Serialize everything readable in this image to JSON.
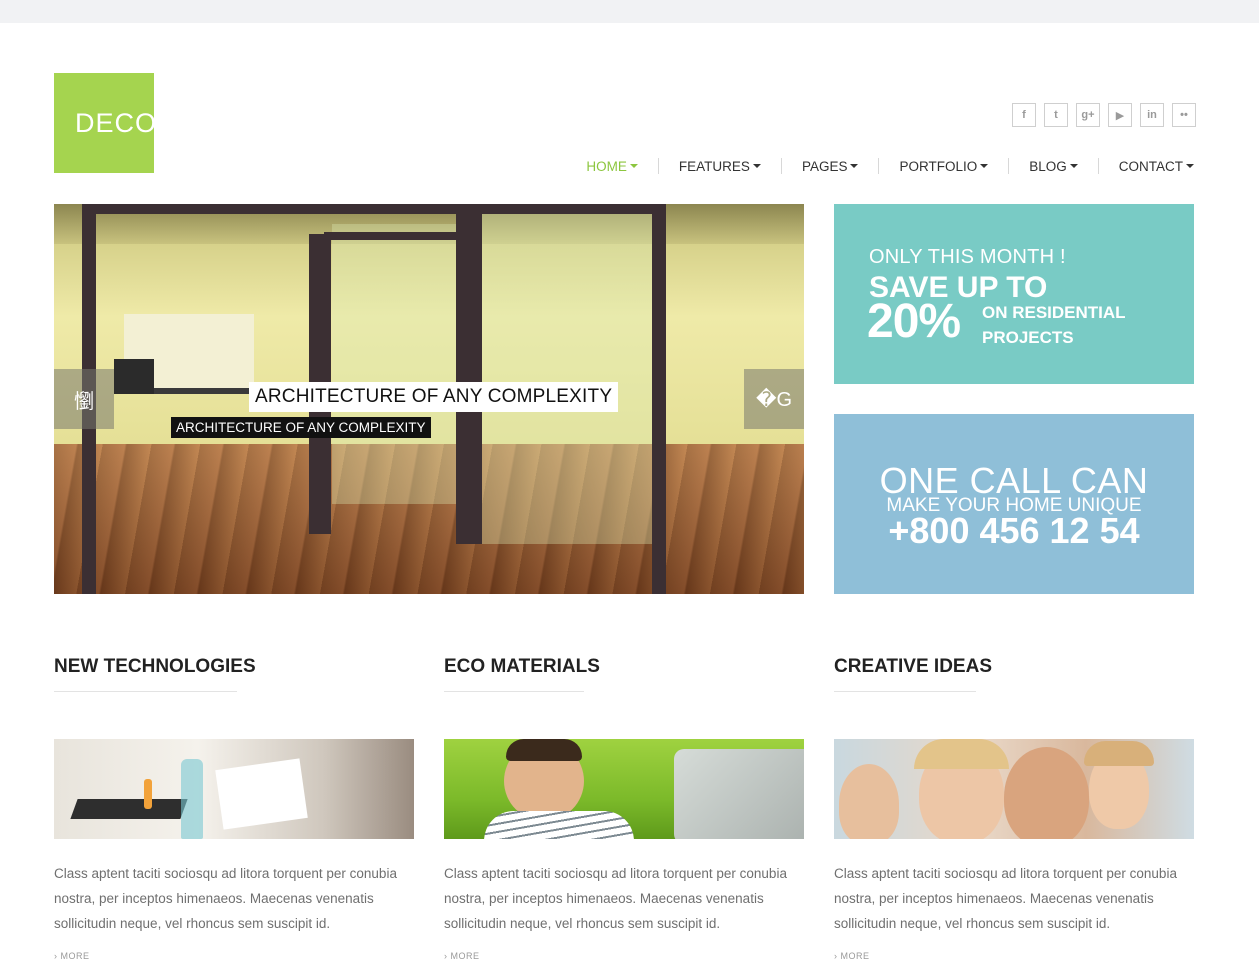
{
  "logo": {
    "text": "DECOR"
  },
  "social": {
    "items": [
      {
        "icon": "facebook-icon",
        "glyph": "f"
      },
      {
        "icon": "twitter-icon",
        "glyph": "t"
      },
      {
        "icon": "google-plus-icon",
        "glyph": "g+"
      },
      {
        "icon": "youtube-icon",
        "glyph": "▶"
      },
      {
        "icon": "linkedin-icon",
        "glyph": "in"
      },
      {
        "icon": "flickr-icon",
        "glyph": "••"
      }
    ]
  },
  "nav": {
    "items": [
      {
        "label": "HOME",
        "active": true
      },
      {
        "label": "FEATURES",
        "active": false
      },
      {
        "label": "PAGES",
        "active": false
      },
      {
        "label": "PORTFOLIO",
        "active": false
      },
      {
        "label": "BLOG",
        "active": false
      },
      {
        "label": "CONTACT",
        "active": false
      }
    ],
    "active_color": "#8cc63f"
  },
  "hero": {
    "caption_title": "ARCHITECTURE OF ANY COMPLEXITY",
    "caption_subtitle": "ARCHITECTURE OF ANY COMPLEXITY",
    "prev_icon": "懰",
    "next_icon": "�G"
  },
  "promo_sale": {
    "line1": "ONLY THIS MONTH !",
    "line2": "SAVE UP TO",
    "line3": "20%",
    "line4": "ON RESIDENTIAL PROJECTS",
    "color": "#79cbc5"
  },
  "promo_call": {
    "line1": "ONE CALL CAN",
    "line2": "MAKE YOUR HOME UNIQUE",
    "phone": "+800 456 12 54",
    "color": "#8fbfd8"
  },
  "features": [
    {
      "title": "NEW TECHNOLOGIES",
      "text": "Class aptent taciti sociosqu ad litora torquent per conubia nostra, per inceptos himenaeos. Maecenas venenatis sollicitudin neque, vel rhoncus sem suscipit id.",
      "more": "› MORE"
    },
    {
      "title": "ECO MATERIALS",
      "text": "Class aptent taciti sociosqu ad litora torquent per conubia nostra, per inceptos himenaeos. Maecenas venenatis sollicitudin neque, vel rhoncus sem suscipit id.",
      "more": "› MORE"
    },
    {
      "title": "CREATIVE IDEAS",
      "text": "Class aptent taciti sociosqu ad litora torquent per conubia nostra, per inceptos himenaeos. Maecenas venenatis sollicitudin neque, vel rhoncus sem suscipit id.",
      "more": "› MORE"
    }
  ],
  "colors": {
    "brand": "#a5d44f"
  }
}
